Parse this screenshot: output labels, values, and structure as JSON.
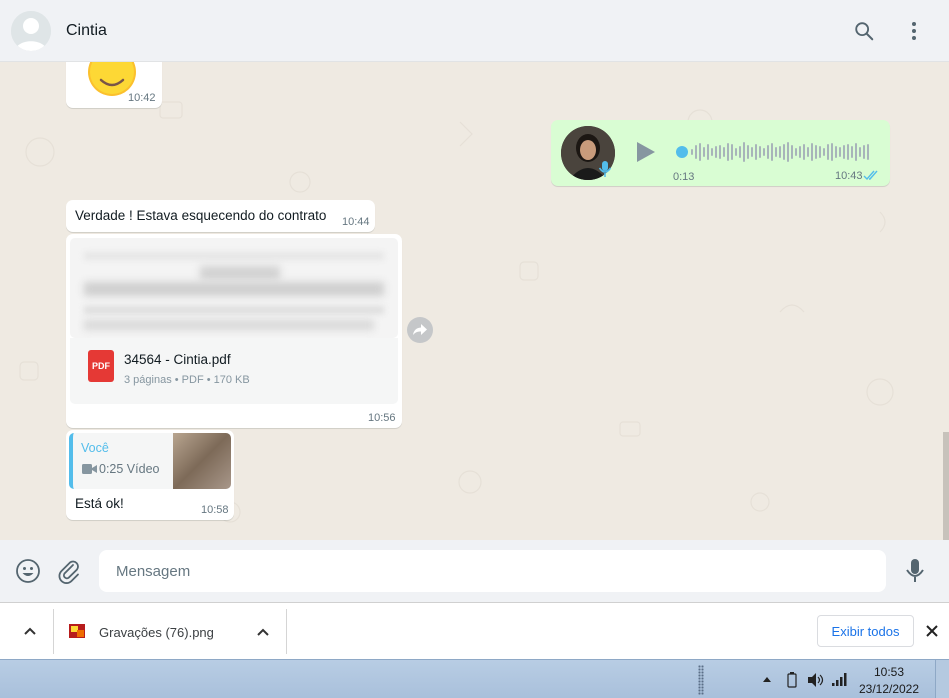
{
  "header": {
    "contact_name": "Cintia",
    "icons": [
      "avatar-placeholder-icon",
      "search-icon",
      "more-vertical-icon"
    ]
  },
  "messages": {
    "emoji_msg": {
      "time": "10:42",
      "emoji": "😉"
    },
    "voice_msg": {
      "duration": "0:13",
      "time": "10:43",
      "status": "read"
    },
    "text_msg": {
      "text": "Verdade ! Estava esquecendo do contrato",
      "time": "10:44"
    },
    "doc_msg": {
      "file_name": "34564 - Cintia.pdf",
      "meta": "3 páginas • PDF • 170 KB",
      "badge": "PDF",
      "time": "10:56"
    },
    "reply_msg": {
      "quoted_author": "Você",
      "quoted_text": "0:25 Vídeo",
      "text": "Está ok!",
      "time": "10:58"
    }
  },
  "composer": {
    "placeholder": "Mensagem"
  },
  "downloads": {
    "file_name": "Gravações (76).png",
    "show_all_label": "Exibir todos"
  },
  "taskbar": {
    "time": "10:53",
    "date": "23/12/2022"
  },
  "colors": {
    "accent": "#53bdeb",
    "outgoing_bubble": "#d9fdd3",
    "pdf_red": "#e53935",
    "chat_bg": "#efeae2"
  }
}
